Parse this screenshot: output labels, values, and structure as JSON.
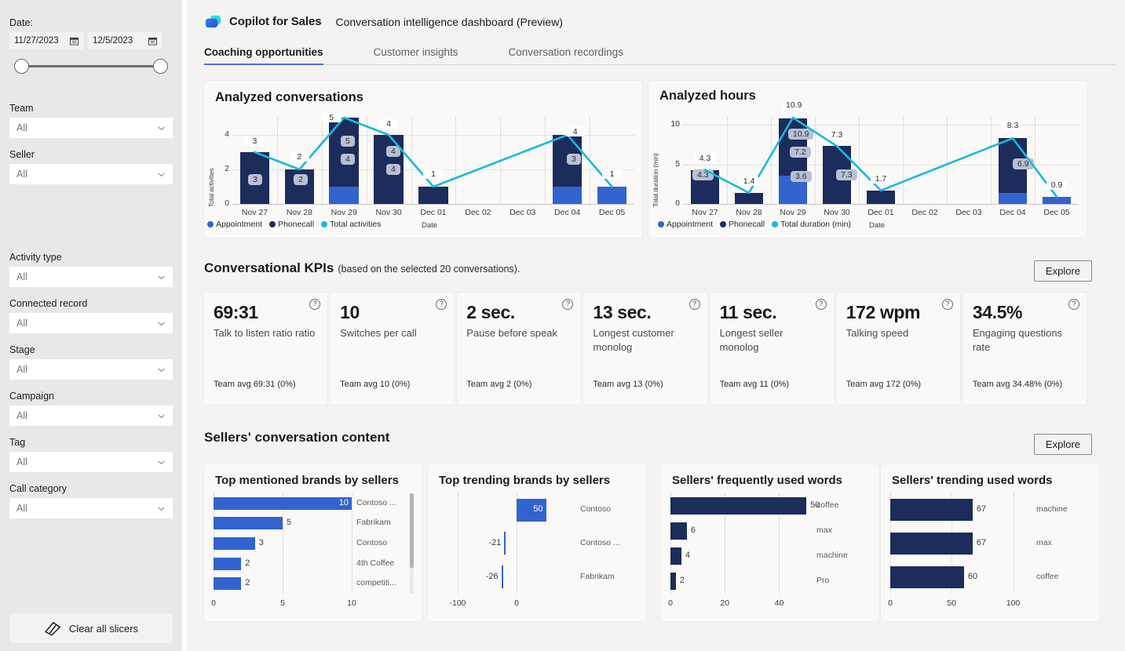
{
  "sidebar": {
    "date_label": "Date:",
    "date_from": "11/27/2023",
    "date_to": "12/5/2023",
    "filters": [
      {
        "label": "Team",
        "value": "All"
      },
      {
        "label": "Seller",
        "value": "All"
      },
      {
        "label": "Activity type",
        "value": "All"
      },
      {
        "label": "Connected record",
        "value": "All"
      },
      {
        "label": "Stage",
        "value": "All"
      },
      {
        "label": "Campaign",
        "value": "All"
      },
      {
        "label": "Tag",
        "value": "All"
      },
      {
        "label": "Call category",
        "value": "All"
      }
    ],
    "clear_button": "Clear all slicers"
  },
  "header": {
    "brand": "Copilot for Sales",
    "subtitle": "Conversation intelligence dashboard  (Preview)",
    "tabs": [
      {
        "label": "Coaching opportunities",
        "active": true
      },
      {
        "label": "Customer insights",
        "active": false
      },
      {
        "label": "Conversation recordings",
        "active": false
      }
    ]
  },
  "sections": {
    "kpi_title": "Conversational KPIs",
    "kpi_subtitle": "(based on the selected 20 conversations).",
    "kpi_explore": "Explore",
    "content_title": "Sellers' conversation content",
    "content_explore": "Explore"
  },
  "kpis": [
    {
      "value": "69:31",
      "label": "Talk to listen ratio ratio",
      "avg": "Team avg 69:31  (0%)"
    },
    {
      "value": "10",
      "label": "Switches per call",
      "avg": "Team avg 10  (0%)"
    },
    {
      "value": "2 sec.",
      "label": "Pause before speak",
      "avg": "Team avg 2 (0%)"
    },
    {
      "value": "13 sec.",
      "label": "Longest customer monolog",
      "avg": "Team avg 13  (0%)"
    },
    {
      "value": "11 sec.",
      "label": "Longest seller monolog",
      "avg": "Team avg 11  (0%)"
    },
    {
      "value": "172 wpm",
      "label": "Talking speed",
      "avg": "Team avg 172  (0%)"
    },
    {
      "value": "34.5%",
      "label": "Engaging questions rate",
      "avg": "Team avg 34.48%  (0%)"
    }
  ],
  "colors": {
    "appointment": "#3263ce",
    "phonecall": "#1c2c5b",
    "total_line": "#19b9dd",
    "accent": "#4f6bed"
  },
  "chart_data": [
    {
      "id": "analyzed_conversations",
      "type": "bar",
      "title": "Analyzed conversations",
      "xlabel": "Date",
      "ylabel": "Total activities",
      "ylim": [
        0,
        5
      ],
      "yticks": [
        0,
        2,
        4
      ],
      "grid": true,
      "legend": [
        "Appointment",
        "Phonecall",
        "Total activities"
      ],
      "legend_position": "bottom-left",
      "categories": [
        "Nov 27",
        "Nov 28",
        "Nov 29",
        "Nov 30",
        "Dec 01",
        "Dec 02",
        "Dec 03",
        "Dec 04",
        "Dec 05"
      ],
      "series": [
        {
          "name": "Appointment",
          "values": [
            0,
            0,
            1,
            0,
            0,
            0,
            0,
            1,
            1
          ]
        },
        {
          "name": "Phonecall",
          "values": [
            3,
            2,
            4,
            4,
            1,
            0,
            0,
            3,
            0
          ]
        },
        {
          "name": "Total activities",
          "values": [
            3,
            2,
            5,
            4,
            1,
            null,
            null,
            4,
            1
          ]
        }
      ],
      "bar_labels": [
        {
          "cat": "Nov 27",
          "text": "3"
        },
        {
          "cat": "Nov 28",
          "text": "2"
        },
        {
          "cat": "Nov 29",
          "text": "5"
        },
        {
          "cat": "Nov 29",
          "text": "4"
        },
        {
          "cat": "Nov 30",
          "text": "4"
        },
        {
          "cat": "Nov 30",
          "text": "4"
        },
        {
          "cat": "Dec 04",
          "text": "3"
        },
        {
          "cat": "Dec 04",
          "text": "4"
        }
      ],
      "line_labels": [
        "3",
        "2",
        "5",
        "4",
        "1",
        "",
        "",
        "4",
        "1"
      ]
    },
    {
      "id": "analyzed_hours",
      "type": "bar",
      "title": "Analyzed hours",
      "xlabel": "Date",
      "ylabel": "Total duration (min)",
      "ylim": [
        0,
        10.9
      ],
      "yticks": [
        0,
        5,
        10
      ],
      "grid": true,
      "legend": [
        "Appointment",
        "Phonecall",
        "Total duration (min)"
      ],
      "legend_position": "bottom-left",
      "categories": [
        "Nov 27",
        "Nov 28",
        "Nov 29",
        "Nov 30",
        "Dec 01",
        "Dec 02",
        "Dec 03",
        "Dec 04",
        "Dec 05"
      ],
      "series": [
        {
          "name": "Appointment",
          "values": [
            0,
            0,
            3.6,
            0,
            0,
            0,
            0,
            1.4,
            0.9
          ]
        },
        {
          "name": "Phonecall",
          "values": [
            4.3,
            1.4,
            7.2,
            7.3,
            1.7,
            0,
            0,
            6.9,
            0
          ]
        },
        {
          "name": "Total duration (min)",
          "values": [
            4.3,
            1.4,
            10.9,
            7.3,
            1.7,
            null,
            null,
            8.3,
            0.9
          ]
        }
      ],
      "bar_labels": [
        {
          "cat": "Nov 27",
          "text": "4.3"
        },
        {
          "cat": "Nov 29",
          "text": "10.9"
        },
        {
          "cat": "Nov 29",
          "text": "7.2"
        },
        {
          "cat": "Nov 29",
          "text": "3.6"
        },
        {
          "cat": "Nov 30",
          "text": "7.3"
        },
        {
          "cat": "Dec 04",
          "text": "6.9"
        }
      ],
      "line_labels": [
        "4.3",
        "1.4",
        "10.9",
        "7.3",
        "1.7",
        "",
        "",
        "8.3",
        "0.9"
      ]
    },
    {
      "id": "top_mentioned_brands",
      "type": "bar",
      "orientation": "horizontal",
      "title": "Top mentioned brands by sellers",
      "categories": [
        "Contoso ...",
        "Fabrikam",
        "Contoso",
        "4th Coffee",
        "competiti..."
      ],
      "values": [
        10,
        5,
        3,
        2,
        2
      ],
      "xticks": [
        0,
        5,
        10
      ],
      "xlim": [
        0,
        10
      ],
      "color": "#3263ce"
    },
    {
      "id": "top_trending_brands",
      "type": "bar",
      "orientation": "horizontal",
      "title": "Top trending brands by sellers",
      "categories": [
        "Contoso",
        "Contoso ...",
        "Fabrikam"
      ],
      "values": [
        50,
        -21,
        -26
      ],
      "xticks": [
        -100,
        0
      ],
      "xlim": [
        -100,
        100
      ],
      "color": "#3263ce"
    },
    {
      "id": "frequently_used_words",
      "type": "bar",
      "orientation": "horizontal",
      "title": "Sellers' frequently used words",
      "categories": [
        "coffee",
        "max",
        "machine",
        "Pro"
      ],
      "values": [
        50,
        6,
        4,
        2
      ],
      "xticks": [
        0,
        20,
        40
      ],
      "xlim": [
        0,
        52
      ],
      "color": "#1c2c5b"
    },
    {
      "id": "trending_used_words",
      "type": "bar",
      "orientation": "horizontal",
      "title": "Sellers' trending used words",
      "categories": [
        "machine",
        "max",
        "coffee"
      ],
      "values": [
        67,
        67,
        60
      ],
      "xticks": [
        0,
        50,
        100
      ],
      "xlim": [
        0,
        115
      ],
      "color": "#1c2c5b"
    }
  ]
}
